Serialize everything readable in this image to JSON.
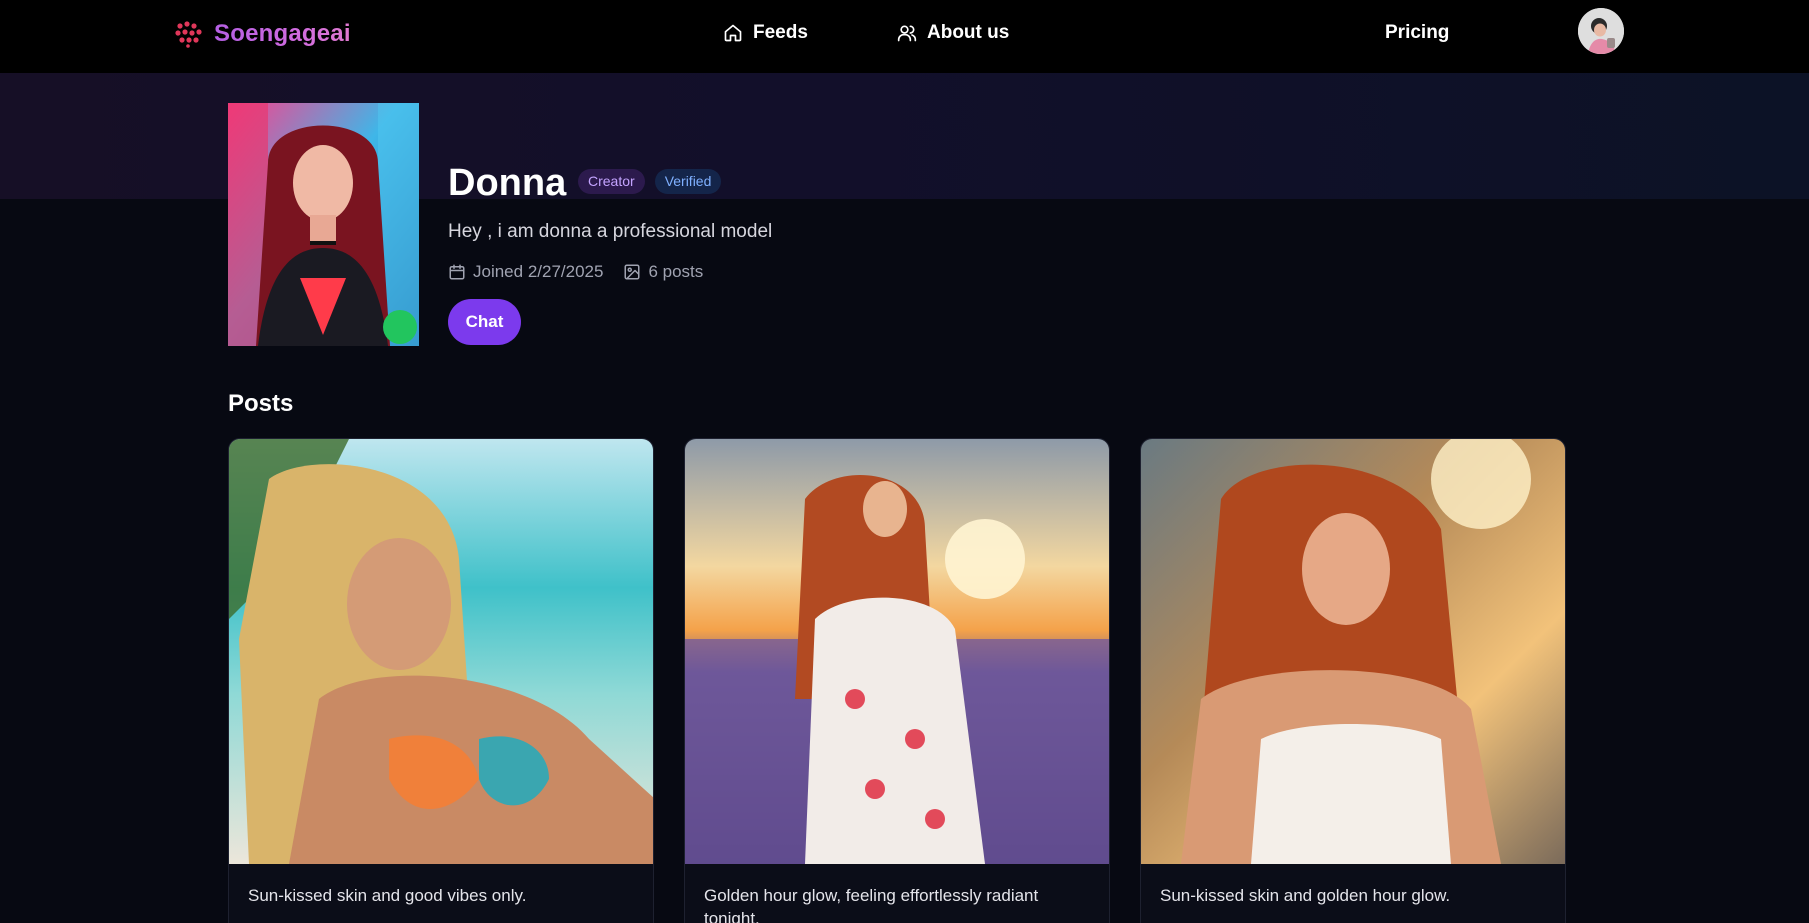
{
  "nav": {
    "brand": "Soengageai",
    "links": [
      {
        "label": "Feeds",
        "icon": "home-icon"
      },
      {
        "label": "About us",
        "icon": "users-icon"
      }
    ],
    "pricing": "Pricing"
  },
  "profile": {
    "name": "Donna",
    "badges": [
      "Creator",
      "Verified"
    ],
    "bio": "Hey , i am donna a professional model",
    "joined": "Joined 2/27/2025",
    "posts_count": "6 posts",
    "chat_label": "Chat",
    "online": true
  },
  "posts": {
    "heading": "Posts",
    "items": [
      {
        "caption": "Sun-kissed skin and good vibes only."
      },
      {
        "caption": "Golden hour glow, feeling effortlessly radiant tonight."
      },
      {
        "caption": "Sun-kissed skin and golden hour glow."
      }
    ]
  },
  "colors": {
    "brand_gradient": [
      "#b45fe3",
      "#e07ad0"
    ],
    "chat_button": "#7c3aed",
    "online": "#22c55e",
    "creator_badge": "#2c1a4d",
    "verified_badge": "#14254a"
  }
}
